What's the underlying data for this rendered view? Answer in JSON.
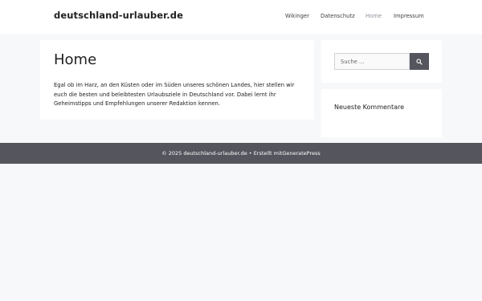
{
  "header": {
    "site_title": "deutschland-urlauber.de",
    "nav": [
      {
        "label": "Wikinger",
        "current": false
      },
      {
        "label": "Datenschutz",
        "current": false
      },
      {
        "label": "Home",
        "current": true
      },
      {
        "label": "Impressum",
        "current": false
      }
    ]
  },
  "main": {
    "title": "Home",
    "text": "Egal ob im Harz, an den Küsten oder im Süden unseres schönen Landes, hier stellen wir euch die besten und beleibtesten Urlaubsziele in Deutschland vor. Dabei lernt ihr Geheimstipps und Empfehlungen unserer Redaktion kennen."
  },
  "sidebar": {
    "search": {
      "placeholder": "Suche ...",
      "button_icon": "search-icon"
    },
    "comments_widget": {
      "title": "Neueste Kommentare"
    }
  },
  "footer": {
    "prefix": "© 2025 deutschland-urlauber.de • Erstellt mit ",
    "link_text": "GeneratePress"
  },
  "colors": {
    "page_background": "#f7f8f9",
    "footer_background": "#55555e",
    "search_button": "#55555e",
    "current_nav": "#8a9099"
  }
}
